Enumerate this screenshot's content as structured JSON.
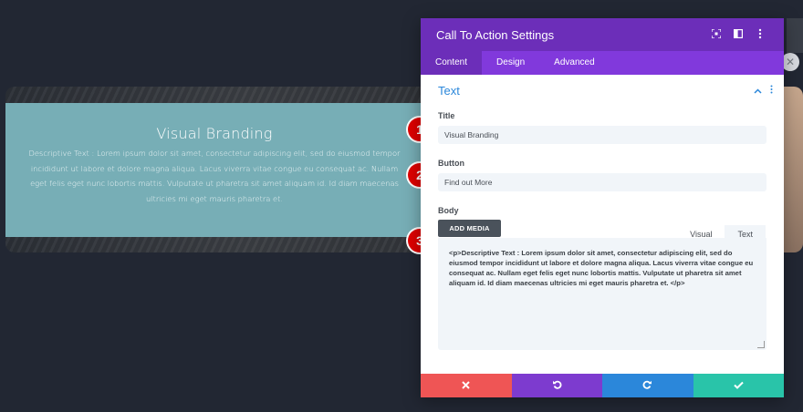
{
  "preview": {
    "title": "Visual Branding",
    "body": "Descriptive Text : Lorem ipsum dolor sit amet, consectetur adipiscing elit, sed do eiusmod tempor incididunt ut labore et dolore magna aliqua. Lacus viverra vitae congue eu consequat ac. Nullam eget felis eget nunc lobortis mattis. Vulputate ut pharetra sit amet aliquam id. Id diam maecenas ultricies mi eget mauris pharetra et."
  },
  "markers": [
    "1",
    "2",
    "3"
  ],
  "panel": {
    "title": "Call To Action Settings",
    "header_icons": [
      "expand-icon",
      "sidebar-toggle-icon",
      "more-options-icon"
    ],
    "tabs": [
      "Content",
      "Design",
      "Advanced"
    ],
    "active_tab": "Content",
    "section_title": "Text",
    "fields": {
      "title_label": "Title",
      "title_value": "Visual Branding",
      "button_label": "Button",
      "button_value": "Find out More",
      "body_label": "Body",
      "add_media": "ADD MEDIA",
      "editor_tab_visual": "Visual",
      "editor_tab_text": "Text",
      "body_value": "<p>Descriptive Text : Lorem ipsum dolor sit amet, consectetur adipiscing elit, sed do eiusmod tempor incididunt ut labore et dolore magna aliqua. Lacus viverra vitae congue eu consequat ac. Nullam eget felis eget nunc lobortis mattis. Vulputate ut pharetra sit amet aliquam id. Id diam maecenas ultricies mi eget mauris pharetra et. </p>"
    },
    "footer": {
      "colors": [
        "#ef5555",
        "#7d3bcf",
        "#2b87da",
        "#29c4a9"
      ],
      "icons": [
        "cancel-icon",
        "undo-icon",
        "redo-icon",
        "save-check-icon"
      ]
    }
  },
  "colors": {
    "header": "#6c2eb9",
    "tabs_bar": "#8139dc",
    "accent_blue": "#2b87da",
    "cta_bg": "#77aeb6",
    "marker_red": "#e00000"
  }
}
